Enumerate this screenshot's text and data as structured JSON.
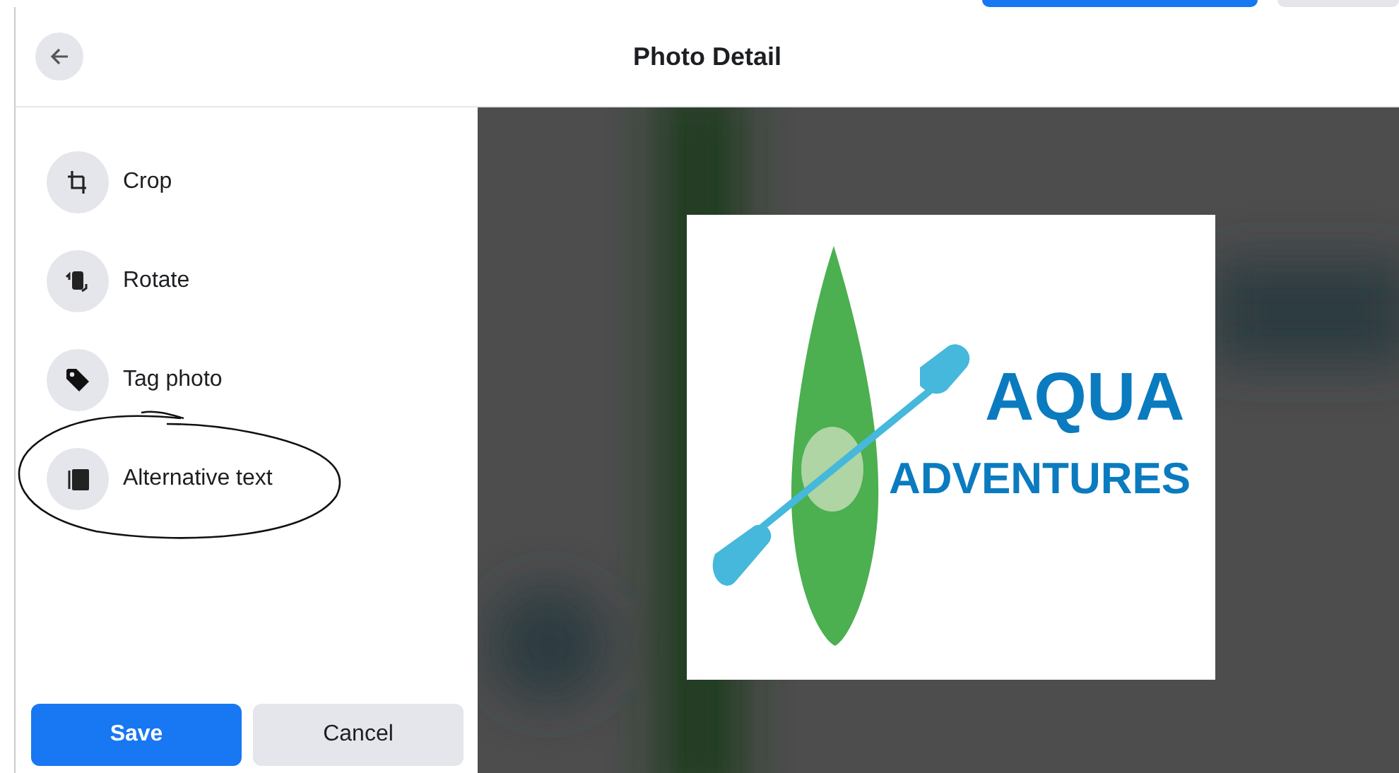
{
  "top_buttons": [
    {
      "kind": "primary"
    },
    {
      "kind": "secondary"
    }
  ],
  "header": {
    "title": "Photo Detail"
  },
  "tools": [
    {
      "label": "Crop",
      "kind": "crop"
    },
    {
      "label": "Rotate",
      "kind": "rotate"
    },
    {
      "label": "Tag photo",
      "kind": "tag"
    },
    {
      "label": "Alternative text",
      "kind": "alt-text"
    }
  ],
  "photo": {
    "logo_lines": [
      "AQUA",
      "ADVENTURES"
    ]
  },
  "buttons": [
    {
      "label": "Save",
      "kind": "primary"
    },
    {
      "label": "Cancel",
      "kind": "secondary"
    }
  ]
}
